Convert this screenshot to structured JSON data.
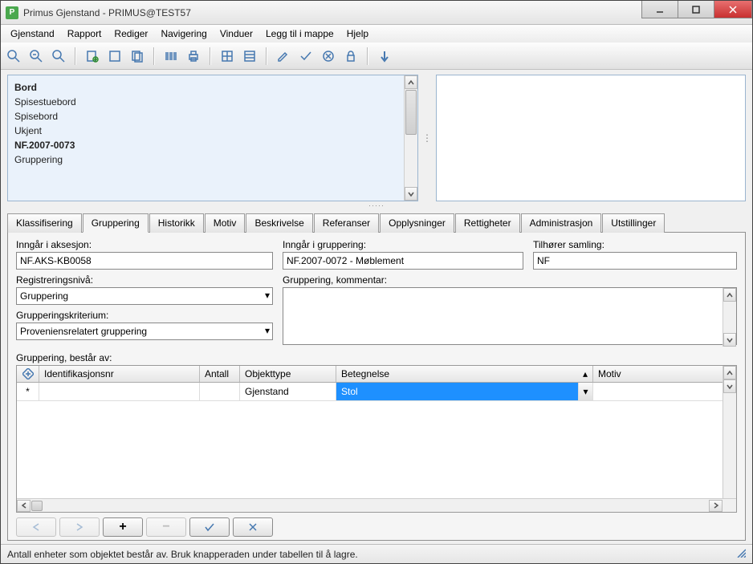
{
  "window": {
    "title": "Primus Gjenstand - PRIMUS@TEST57"
  },
  "menu": [
    "Gjenstand",
    "Rapport",
    "Rediger",
    "Navigering",
    "Vinduer",
    "Legg til i mappe",
    "Hjelp"
  ],
  "list_items": [
    {
      "text": "Bord",
      "bold": true
    },
    {
      "text": "Spisestuebord",
      "bold": false
    },
    {
      "text": "Spisebord",
      "bold": false
    },
    {
      "text": "Ukjent",
      "bold": false
    },
    {
      "text": "NF.2007-0073",
      "bold": true
    },
    {
      "text": "Gruppering",
      "bold": false
    }
  ],
  "tabs": [
    "Klassifisering",
    "Gruppering",
    "Historikk",
    "Motiv",
    "Beskrivelse",
    "Referanser",
    "Opplysninger",
    "Rettigheter",
    "Administrasjon",
    "Utstillinger"
  ],
  "labels": {
    "aksesjon": "Inngår i aksesjon:",
    "gruppering": "Inngår i gruppering:",
    "samling": "Tilhører samling:",
    "registreringsniva": "Registreringsnivå:",
    "komm": "Gruppering, kommentar:",
    "kriterium": "Grupperingskriterium:",
    "bestar": "Gruppering,  består av:"
  },
  "fields": {
    "aksesjon": "NF.AKS-KB0058",
    "gruppering": "NF.2007-0072 - Møblement",
    "samling": "NF",
    "registreringsniva": "Gruppering",
    "kriterium": "Proveniensrelatert gruppering",
    "komm": ""
  },
  "grid": {
    "headers": [
      "Identifikasjonsnr",
      "Antall",
      "Objekttype",
      "Betegnelse",
      "Motiv"
    ],
    "row": {
      "ident": "",
      "antall": "",
      "objekttype": "Gjenstand",
      "betegnelse": "Stol",
      "motiv": ""
    }
  },
  "status": "Antall enheter som objektet består av. Bruk knapperaden under tabellen til å lagre."
}
